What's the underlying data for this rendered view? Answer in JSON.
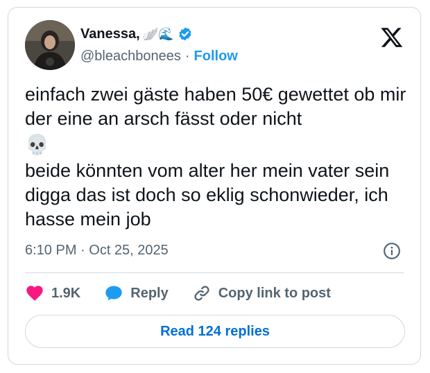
{
  "author": {
    "display_name": "Vanessa,",
    "name_decoration": "🪽🌊",
    "handle": "@bleachbonees",
    "separator": "·",
    "follow_label": "Follow"
  },
  "tweet": {
    "line1": "einfach zwei gäste haben 50€ gewettet ob mir der eine an arsch fässt oder nicht",
    "emoji": "💀",
    "line2": "beide könnten vom alter her mein vater sein digga das ist doch so eklig schonwieder, ich hasse mein job",
    "timestamp": "6:10 PM · Oct 25, 2025"
  },
  "actions": {
    "likes": "1.9K",
    "reply_label": "Reply",
    "copy_label": "Copy link to post"
  },
  "read_replies_label": "Read 124 replies",
  "colors": {
    "accent": "#1d9bf0",
    "like": "#f91880",
    "link_text": "#006fd6",
    "muted": "#536471",
    "border": "#cfd9de"
  },
  "icons": [
    "x-logo-icon",
    "verified-badge-icon",
    "info-icon",
    "heart-icon",
    "reply-bubble-icon",
    "link-icon"
  ]
}
